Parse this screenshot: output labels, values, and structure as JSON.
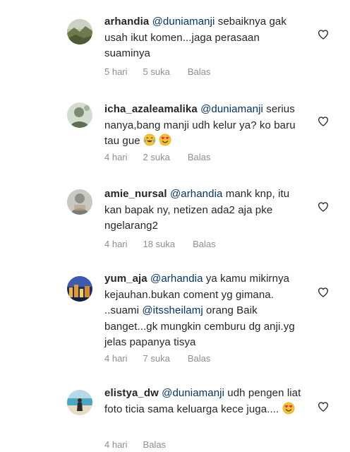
{
  "comments": [
    {
      "username": "arhandia",
      "mention": "@duniamanji",
      "text": " sebaiknya gak usah ikut komen...jaga perasaan suaminya",
      "time": "5 hari",
      "likes": "5 suka",
      "reply": "Balas",
      "avatar_icon": "avatar-landscape-icon"
    },
    {
      "username": "icha_azaleamalika",
      "mention": "@duniamanji",
      "text": " serius nanya,bang manji udh kelur ya? ko baru tau gue ",
      "emojis": [
        "face-with-tears-of-joy-icon",
        "smiling-face-with-heart-eyes-icon"
      ],
      "time": "4 hari",
      "likes": "2 suka",
      "reply": "Balas",
      "avatar_icon": "avatar-person-icon"
    },
    {
      "username": "amie_nursal",
      "mention": "@arhandia",
      "text": " mank knp, itu kan bapak ny, netizen ada2 aja pke ngelarang2",
      "time": "4 hari",
      "likes": "18 suka",
      "reply": "Balas",
      "avatar_icon": "avatar-default-icon"
    },
    {
      "username": "yum_aja",
      "mention": "@arhandia",
      "text": " ya kamu mikirnya kejauhan.bukan coment yg gimana. ..suami ",
      "mention2": "@itssheilamj",
      "text2": " orang Baik banget...gk mungkin cemburu dg anji.yg jelas papanya tisya",
      "time": "4 hari",
      "likes": "7 suka",
      "reply": "Balas",
      "avatar_icon": "avatar-city-night-icon"
    },
    {
      "username": "elistya_dw",
      "mention": "@duniamanji",
      "text": " udh pengen liat foto ticia sama keluarga kece juga.... ",
      "emojis": [
        "smiling-face-with-heart-eyes-icon"
      ],
      "time": "4 hari",
      "reply": "Balas",
      "avatar_icon": "avatar-beach-icon"
    }
  ],
  "colors": {
    "mention": "#003569",
    "text": "#262626",
    "meta": "#8e8e8e"
  }
}
